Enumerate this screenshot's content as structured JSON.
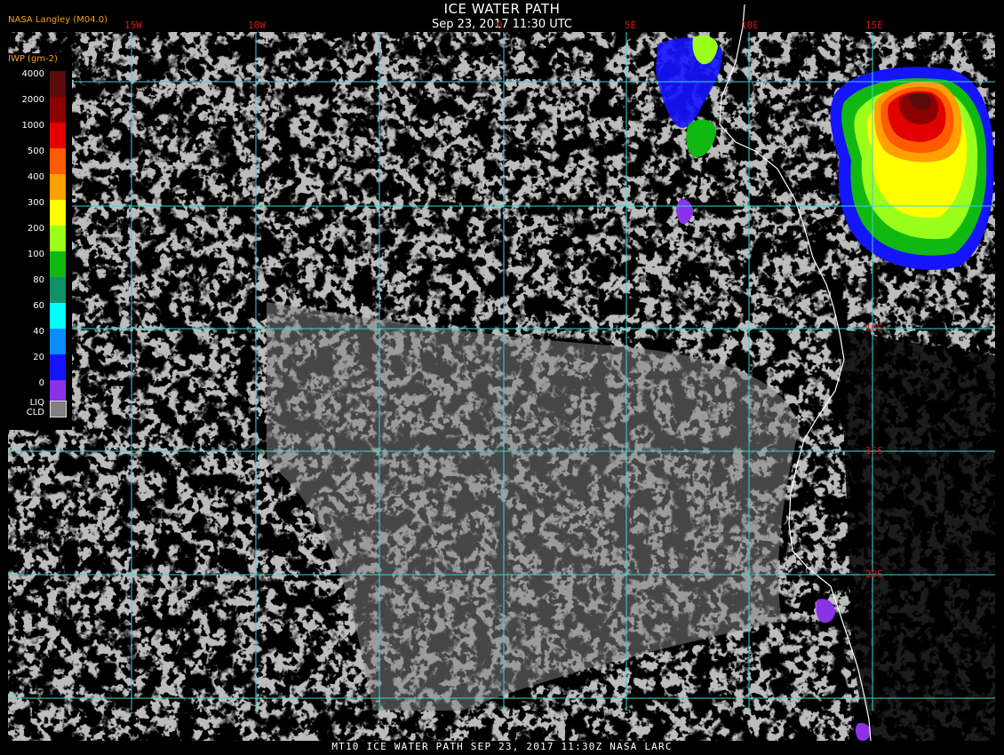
{
  "header": {
    "title": "ICE WATER PATH",
    "subtitle": "Sep 23, 2017 11:30 UTC",
    "source": "NASA Langley (M04.0)"
  },
  "footer": "MT10  ICE WATER PATH  SEP 23, 2017 11:30Z  NASA LARC",
  "grid": {
    "longitudes": [
      "15W",
      "10W",
      "0",
      "5E",
      "10E",
      "15E"
    ],
    "latitudes": [
      "10S",
      "15S",
      "20S"
    ],
    "line_color": "#3fd2d2",
    "label_color": "#d41818"
  },
  "legend": {
    "title": "IWP (gm-2)",
    "entries": [
      {
        "label": "4000",
        "color": "#5a0c0c"
      },
      {
        "label": "2000",
        "color": "#8c0000"
      },
      {
        "label": "1000",
        "color": "#e00000"
      },
      {
        "label": "500",
        "color": "#ff5a00"
      },
      {
        "label": "400",
        "color": "#ffa000"
      },
      {
        "label": "300",
        "color": "#ffff00"
      },
      {
        "label": "200",
        "color": "#9aff1a"
      },
      {
        "label": "100",
        "color": "#12b812"
      },
      {
        "label": "80",
        "color": "#12906a"
      },
      {
        "label": "60",
        "color": "#00ffff"
      },
      {
        "label": "40",
        "color": "#0a8cff"
      },
      {
        "label": "20",
        "color": "#1414ff"
      },
      {
        "label": "0",
        "color": "#8a32e6"
      }
    ],
    "liquid_cloud_label_1": "LIQ",
    "liquid_cloud_label_2": "CLD",
    "liquid_cloud_color": "#808080"
  },
  "colors": {
    "background": "#000000",
    "cloud_gray": "#808080",
    "coastline": "#ffffff"
  }
}
